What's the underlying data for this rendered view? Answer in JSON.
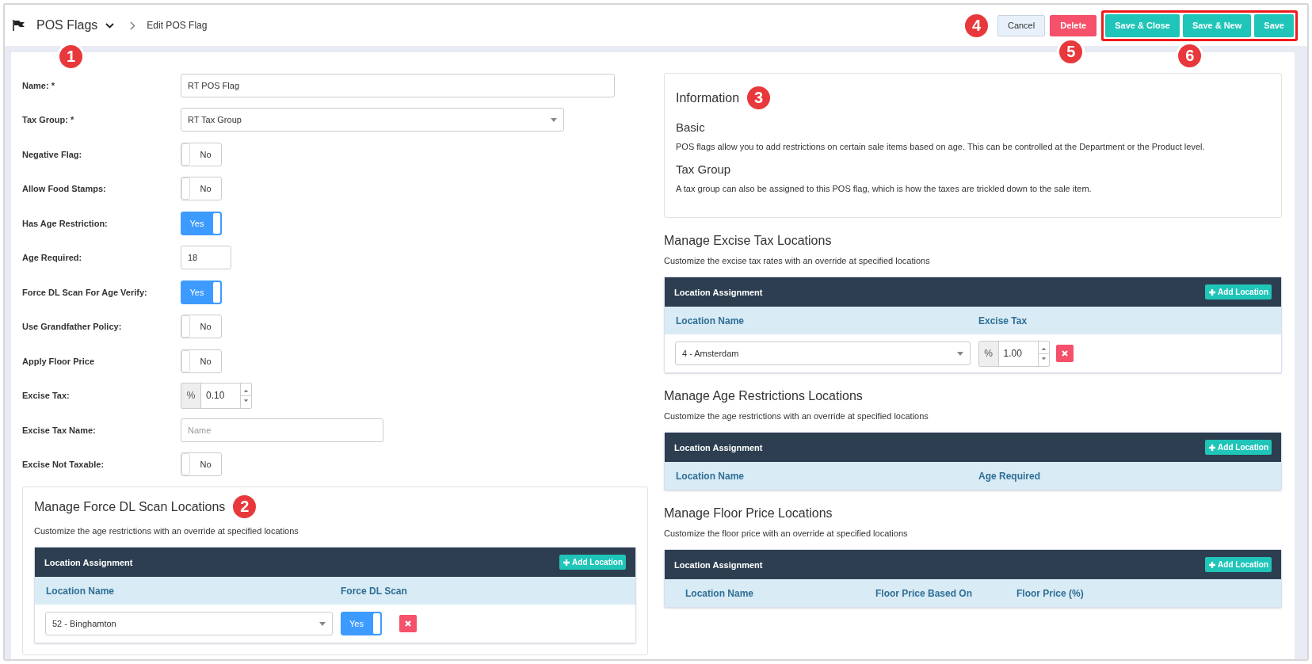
{
  "header": {
    "title": "POS Flags",
    "title_marker": "1",
    "breadcrumb": "Edit POS Flag",
    "cancel": {
      "label": "Cancel",
      "marker": "4"
    },
    "delete": {
      "label": "Delete",
      "marker": "5"
    },
    "save_group": {
      "highlighted": true,
      "marker": "6",
      "buttons": [
        "Save & Close",
        "Save & New",
        "Save"
      ]
    }
  },
  "form": [
    {
      "label": "Name: *",
      "kind": "text",
      "value": "RT POS Flag"
    },
    {
      "label": "Tax Group: *",
      "kind": "select",
      "value": "RT Tax Group"
    },
    {
      "label": "Negative Flag:",
      "kind": "toggle",
      "on": false,
      "text": "No"
    },
    {
      "label": "Allow Food Stamps:",
      "kind": "toggle",
      "on": false,
      "text": "No"
    },
    {
      "label": "Has Age Restriction:",
      "kind": "toggle",
      "on": true,
      "text": "Yes"
    },
    {
      "label": "Age Required:",
      "kind": "number",
      "value": "18"
    },
    {
      "label": "Force DL Scan For Age Verify:",
      "kind": "toggle",
      "on": true,
      "text": "Yes"
    },
    {
      "label": "Use Grandfather Policy:",
      "kind": "toggle",
      "on": false,
      "text": "No"
    },
    {
      "label": "Apply Floor Price",
      "kind": "toggle",
      "on": false,
      "text": "No"
    },
    {
      "label": "Excise Tax:",
      "kind": "percent",
      "symbol": "%",
      "value": "0.10"
    },
    {
      "label": "Excise Tax Name:",
      "kind": "text_short",
      "placeholder": "Name"
    },
    {
      "label": "Excise Not Taxable:",
      "kind": "toggle",
      "on": false,
      "text": "No"
    }
  ],
  "force_dl_section": {
    "title": "Manage Force DL Scan Locations",
    "marker": "2",
    "subtitle": "Customize the age restrictions with an override at specified locations",
    "table": {
      "title": "Location Assignment",
      "add_button": "Add Location",
      "columns": [
        "Location Name",
        "Force DL Scan"
      ],
      "rows": [
        [
          {
            "kind": "select",
            "value": "52 - Binghamton"
          },
          {
            "kind": "toggle",
            "on": true,
            "text": "Yes"
          }
        ]
      ]
    }
  },
  "information": {
    "title": "Information",
    "marker": "3",
    "blocks": [
      {
        "heading": "Basic",
        "text": "POS flags allow you to add restrictions on certain sale items based on age. This can be controlled at the Department or the Product level."
      },
      {
        "heading": "Tax Group",
        "text": "A tax group can also be assigned to this POS flag, which is how the taxes are trickled down to the sale item."
      }
    ]
  },
  "location_sections": [
    {
      "title": "Manage Excise Tax Locations",
      "subtitle": "Customize the excise tax rates with an override at specified locations",
      "table": {
        "title": "Location Assignment",
        "add_button": "Add Location",
        "columns": [
          "Location Name",
          "Excise Tax"
        ],
        "rows": [
          [
            {
              "kind": "select",
              "value": "4 - Amsterdam"
            },
            {
              "kind": "percent",
              "symbol": "%",
              "value": "1.00"
            }
          ]
        ]
      }
    },
    {
      "title": "Manage Age Restrictions Locations",
      "subtitle": "Customize the age restrictions with an override at specified locations",
      "table": {
        "title": "Location Assignment",
        "add_button": "Add Location",
        "columns": [
          "Location Name",
          "Age Required"
        ]
      }
    },
    {
      "title": "Manage Floor Price Locations",
      "subtitle": "Customize the floor price with an override at specified locations",
      "table": {
        "title": "Location Assignment",
        "add_button": "Add Location",
        "columns": [
          "Location Name",
          "Floor Price Based On",
          "Floor Price (%)"
        ]
      }
    }
  ]
}
